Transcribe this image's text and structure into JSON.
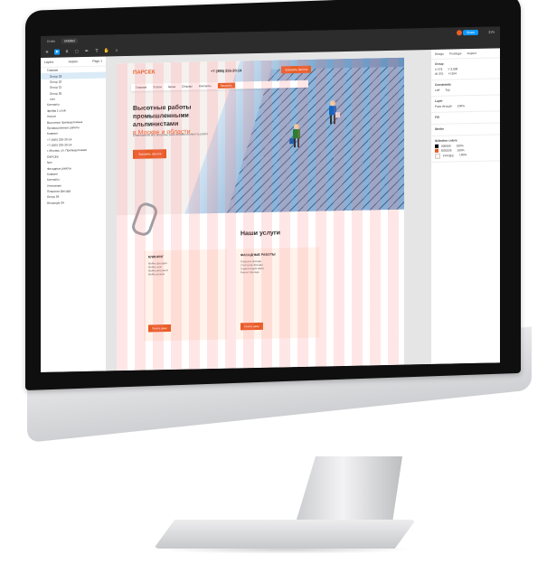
{
  "window": {
    "tab_inactive": "Drafts",
    "tab_active": "Untitled",
    "share_label": "Share",
    "zoom": "31%"
  },
  "layers_panel": {
    "tab_layers": "Layers",
    "tab_assets": "Assets",
    "page": "Page 1",
    "items": [
      "Главная",
      "Group 33",
      "Group 32",
      "Group 31",
      "Group 30",
      "Line",
      "Контакты",
      "Фрейм 1 слой",
      "Услуги",
      "Высотные промышленные",
      "Промышленные работы",
      "Клининг",
      "+7 (495) 255-20-14",
      "+7 (495) 255-20-14",
      "г. Москва, ул. Промышленная",
      "ПАРСЕК",
      "Nav",
      "Фасадные работы",
      "Клининг",
      "Контакты",
      "Утепление",
      "Покраска фасада",
      "Group 34",
      "Rectangle 34"
    ]
  },
  "site": {
    "logo": "ПАРСЕК",
    "phone": "+7 (495) 255-20-14",
    "top_cta": "Заказать звонок",
    "nav": [
      "Главная",
      "Услуги",
      "Цены",
      "Отзывы",
      "Контакты"
    ],
    "nav_cta": "Заказать",
    "hero_title": "Высотные работы промышленными альпинистами",
    "hero_title_accent": "в Москве и области",
    "hero_sub": "Отвечаем на все вопросы, рассчитаем стоимость работ",
    "hero_button": "Заказать звонок",
    "services_title": "Наши услуги",
    "cards": [
      {
        "title": "КЛИНИНГ",
        "items": [
          "Мойка фасадов",
          "Мойка окон",
          "Мойка витражей",
          "Мойка кровли"
        ],
        "button": "Узнать цену"
      },
      {
        "title": "ФАСАДНЫЕ РАБОТЫ",
        "items": [
          "Покраска фасада",
          "Утепление фасада",
          "Герметизация швов",
          "Ремонт фасада"
        ],
        "button": "Узнать цену"
      }
    ]
  },
  "design_panel": {
    "tabs": [
      "Design",
      "Prototype",
      "Inspect"
    ],
    "group_title": "Group",
    "x": "X 573",
    "y": "Y 3,038",
    "w": "W 370",
    "h": "H 264",
    "constraints_title": "Constraints",
    "constraint_h": "Left",
    "constraint_v": "Top",
    "layer_title": "Layer",
    "blend": "Pass through",
    "opacity": "100%",
    "fill_title": "Fill",
    "stroke_title": "Stroke",
    "selection_colors_title": "Selection colors",
    "colors": [
      {
        "hex": "000000",
        "pct": "100%",
        "swatch": "#000000"
      },
      {
        "hex": "E85D26",
        "pct": "100%",
        "swatch": "#e85d26"
      },
      {
        "hex": "FFF3EC",
        "pct": "100%",
        "swatch": "#fff3ec"
      }
    ]
  }
}
